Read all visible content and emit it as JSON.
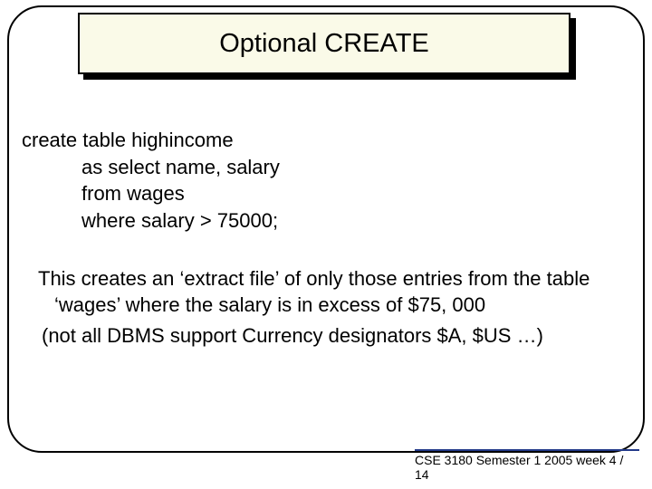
{
  "title": "Optional CREATE",
  "code": {
    "l1": "create table highincome",
    "l2": "as select  name, salary",
    "l3": "from wages",
    "l4": "where salary > 75000;"
  },
  "para1a": "This creates an ‘extract file’ of only those entries from the table ‘wages’ where the salary is in excess of $75, 000",
  "para1b": "(not all DBMS support Currency designators   $A, $US …)",
  "footer": "CSE 3180 Semester 1 2005  week 4 / 14"
}
